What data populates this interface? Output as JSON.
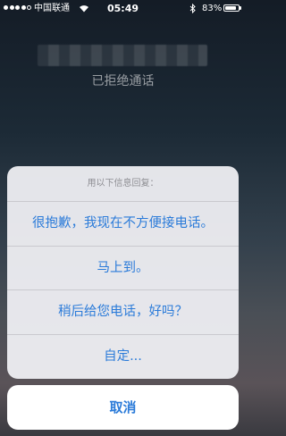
{
  "status_bar": {
    "carrier": "中国联通",
    "time": "05:49",
    "battery_percent": "83%",
    "battery_level": 0.83,
    "signal_strength": 4,
    "signal_max": 5,
    "icons": [
      "signal-dots-icon",
      "wifi-icon",
      "bluetooth-icon",
      "battery-icon"
    ]
  },
  "call": {
    "status": "已拒绝通话"
  },
  "action_sheet": {
    "title": "用以下信息回复：",
    "options": [
      "很抱歉，我现在不方便接电话。",
      "马上到。",
      "稍后给您电话，好吗？",
      "自定..."
    ],
    "cancel_label": "取消"
  },
  "colors": {
    "accent": "#2b7bd9",
    "sheet_bg": "#f0f0f4",
    "separator": "#c9c9ce",
    "subtitle_gray": "#8e8e93"
  }
}
